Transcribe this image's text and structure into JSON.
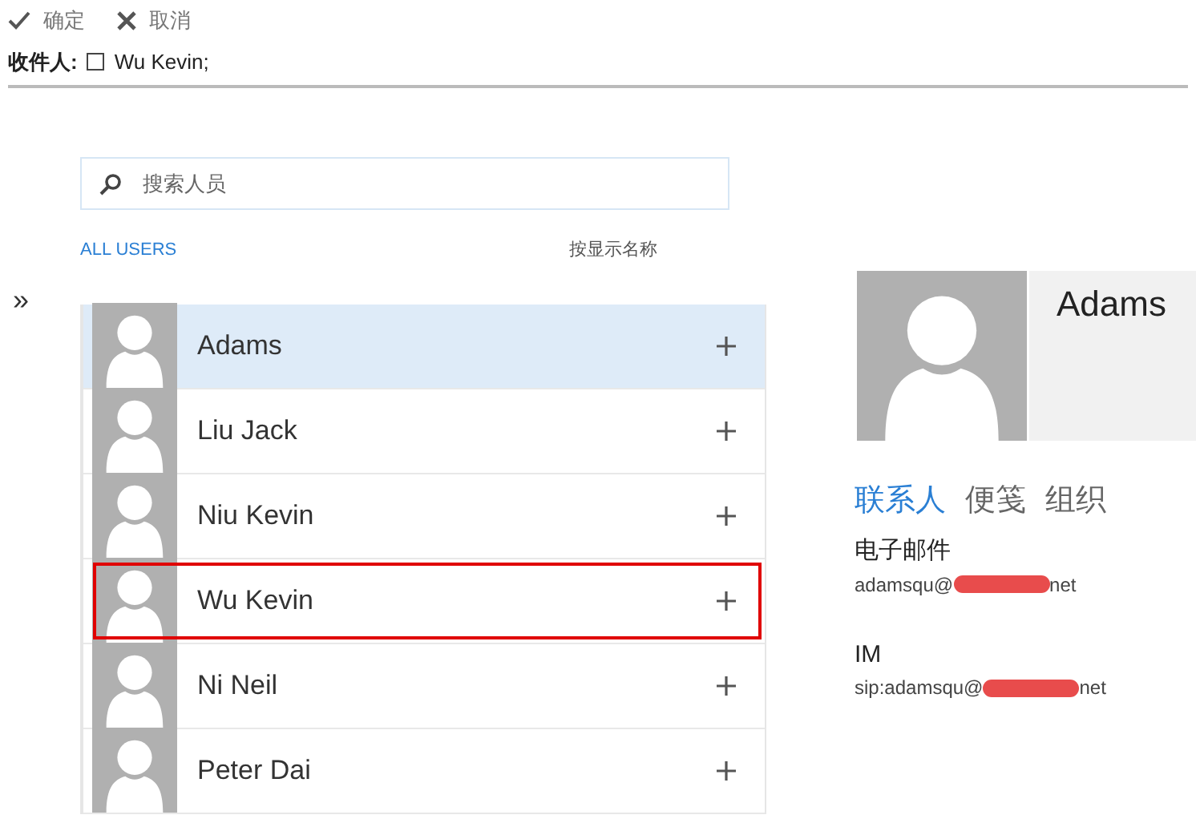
{
  "toolbar": [
    {
      "kind": "ok",
      "label": "确定"
    },
    {
      "kind": "cancel",
      "label": "取消"
    }
  ],
  "recipients": {
    "label": "收件人:",
    "entries": [
      {
        "name": "Wu Kevin;",
        "checked": false
      }
    ]
  },
  "search": {
    "placeholder": "搜索人员"
  },
  "filter": "ALL USERS",
  "sort": "按显示名称",
  "expand": "»",
  "people": [
    {
      "name": "Adams",
      "selected": true,
      "highlighted": false
    },
    {
      "name": "Liu Jack",
      "selected": false,
      "highlighted": false
    },
    {
      "name": "Niu Kevin",
      "selected": false,
      "highlighted": false
    },
    {
      "name": "Wu Kevin",
      "selected": false,
      "highlighted": true
    },
    {
      "name": "Ni Neil",
      "selected": false,
      "highlighted": false
    },
    {
      "name": "Peter Dai",
      "selected": false,
      "highlighted": false
    }
  ],
  "details": {
    "name": "Adams",
    "tabs": [
      {
        "label": "联系人",
        "selected": true
      },
      {
        "label": "便笺",
        "selected": false
      },
      {
        "label": "组织",
        "selected": false
      }
    ],
    "fields": [
      {
        "label": "电子邮件",
        "before": "adamsqu@",
        "after": "net",
        "redacted": true
      },
      {
        "label": "IM",
        "before": "sip:adamsqu@",
        "after": "net",
        "redacted": true
      }
    ]
  }
}
